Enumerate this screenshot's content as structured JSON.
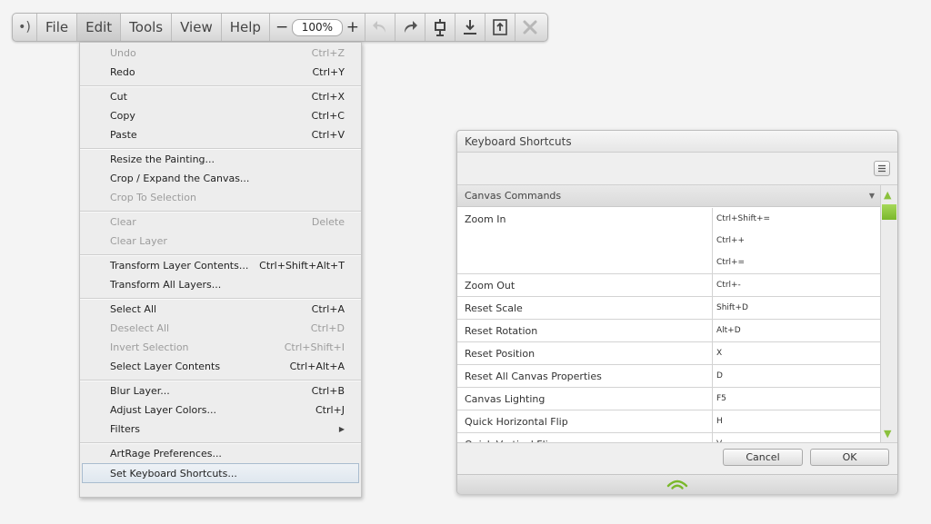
{
  "toolbar": {
    "logo": "•)",
    "menus": [
      "File",
      "Edit",
      "Tools",
      "View",
      "Help"
    ],
    "active_menu": "Edit",
    "zoom_minus": "−",
    "zoom_value": "100%",
    "zoom_plus": "+",
    "icons": [
      "undo-icon",
      "redo-icon",
      "canvas-position-icon",
      "import-icon",
      "export-icon",
      "close-icon"
    ]
  },
  "edit_menu": {
    "groups": [
      [
        {
          "label": "Undo",
          "shortcut": "Ctrl+Z",
          "disabled": true
        },
        {
          "label": "Redo",
          "shortcut": "Ctrl+Y",
          "disabled": false
        }
      ],
      [
        {
          "label": "Cut",
          "shortcut": "Ctrl+X",
          "disabled": false
        },
        {
          "label": "Copy",
          "shortcut": "Ctrl+C",
          "disabled": false
        },
        {
          "label": "Paste",
          "shortcut": "Ctrl+V",
          "disabled": false
        }
      ],
      [
        {
          "label": "Resize the Painting...",
          "shortcut": "",
          "disabled": false
        },
        {
          "label": "Crop / Expand the Canvas...",
          "shortcut": "",
          "disabled": false
        },
        {
          "label": "Crop To Selection",
          "shortcut": "",
          "disabled": true
        }
      ],
      [
        {
          "label": "Clear",
          "shortcut": "Delete",
          "disabled": true
        },
        {
          "label": "Clear Layer",
          "shortcut": "",
          "disabled": true
        }
      ],
      [
        {
          "label": "Transform Layer Contents...",
          "shortcut": "Ctrl+Shift+Alt+T",
          "disabled": false
        },
        {
          "label": "Transform All Layers...",
          "shortcut": "",
          "disabled": false
        }
      ],
      [
        {
          "label": "Select All",
          "shortcut": "Ctrl+A",
          "disabled": false
        },
        {
          "label": "Deselect All",
          "shortcut": "Ctrl+D",
          "disabled": true
        },
        {
          "label": "Invert Selection",
          "shortcut": "Ctrl+Shift+I",
          "disabled": true
        },
        {
          "label": "Select Layer Contents",
          "shortcut": "Ctrl+Alt+A",
          "disabled": false
        }
      ],
      [
        {
          "label": "Blur Layer...",
          "shortcut": "Ctrl+B",
          "disabled": false
        },
        {
          "label": "Adjust Layer Colors...",
          "shortcut": "Ctrl+J",
          "disabled": false
        },
        {
          "label": "Filters",
          "shortcut": "",
          "disabled": false,
          "submenu": true
        }
      ],
      [
        {
          "label": "ArtRage Preferences...",
          "shortcut": "",
          "disabled": false
        },
        {
          "label": "Set Keyboard Shortcuts...",
          "shortcut": "",
          "disabled": false,
          "highlighted": true
        }
      ]
    ],
    "submenu_arrow": "▶"
  },
  "dialog": {
    "title": "Keyboard Shortcuts",
    "section": "Canvas Commands",
    "section_arrow": "▼",
    "rows": [
      {
        "command": "Zoom In",
        "keys": [
          "Ctrl+Shift+=",
          "Ctrl++",
          "Ctrl+="
        ]
      },
      {
        "command": "Zoom Out",
        "keys": [
          "Ctrl+-"
        ]
      },
      {
        "command": "Reset Scale",
        "keys": [
          "Shift+D"
        ]
      },
      {
        "command": "Reset Rotation",
        "keys": [
          "Alt+D"
        ]
      },
      {
        "command": "Reset Position",
        "keys": [
          "X"
        ]
      },
      {
        "command": "Reset All Canvas Properties",
        "keys": [
          "D"
        ]
      },
      {
        "command": "Canvas Lighting",
        "keys": [
          "F5"
        ]
      },
      {
        "command": "Quick Horizontal Flip",
        "keys": [
          "H"
        ]
      },
      {
        "command": "Quick Vertical Flip",
        "keys": [
          "V"
        ]
      }
    ],
    "scroll_up": "▲",
    "scroll_down": "▼",
    "cancel_label": "Cancel",
    "ok_label": "OK"
  },
  "colors": {
    "accent_green": "#7ab82b",
    "menu_highlight_border": "#a9bccf"
  }
}
